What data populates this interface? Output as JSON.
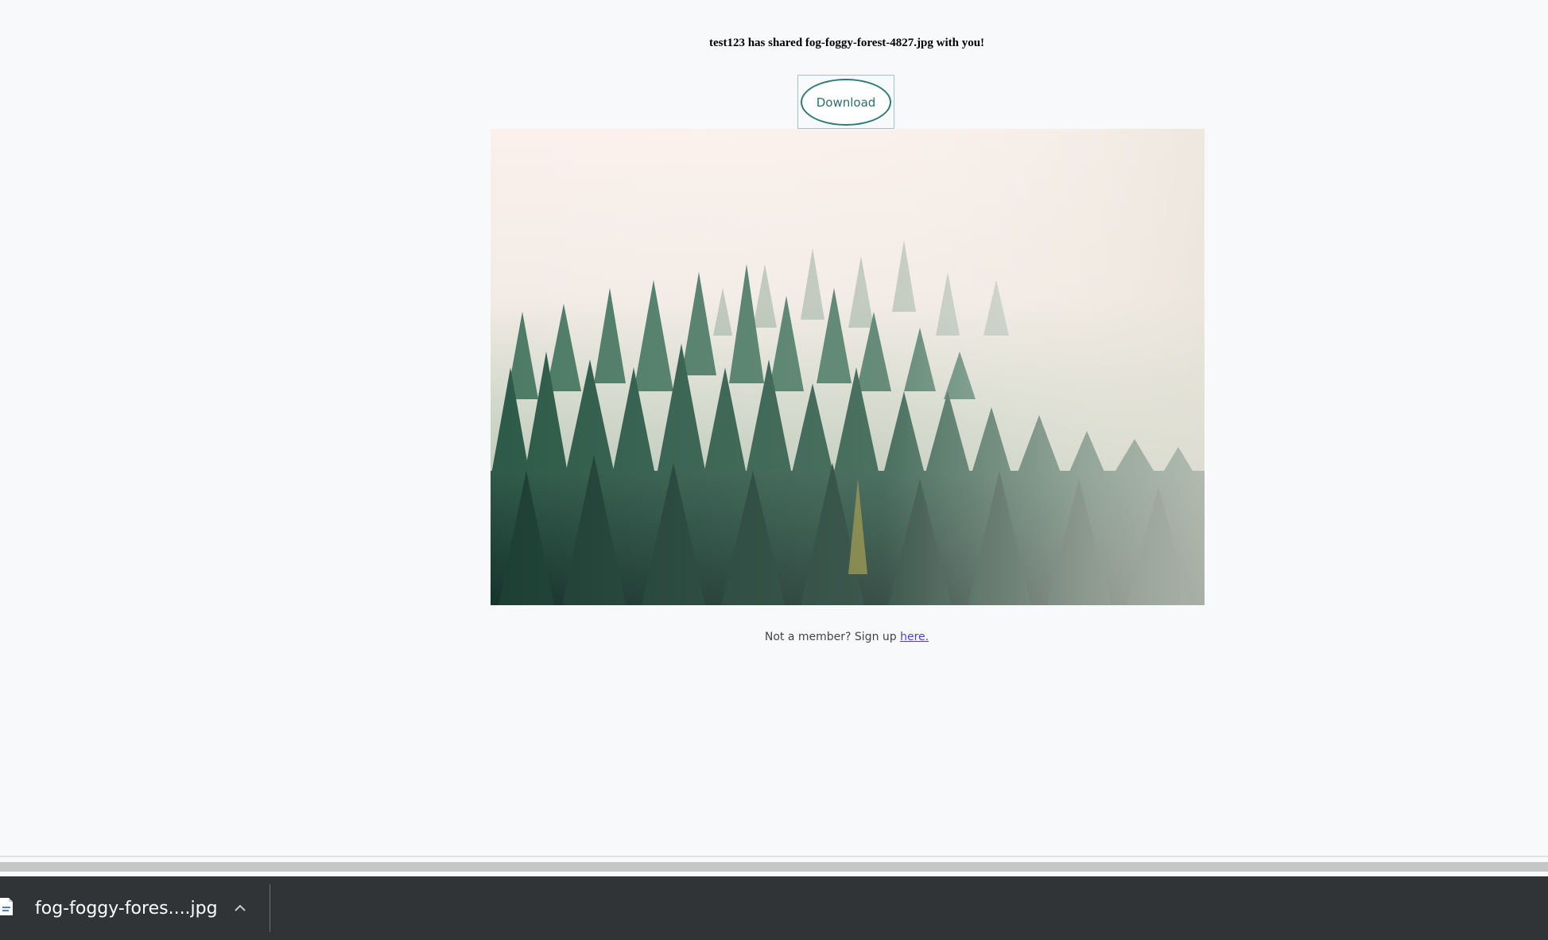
{
  "share": {
    "heading": "test123 has shared fog-foggy-forest-4827.jpg with you!"
  },
  "actions": {
    "download_label": "Download"
  },
  "shared_image": {
    "alt": "fog-foggy-forest-4827.jpg"
  },
  "signup": {
    "prompt": "Not a member? Sign up ",
    "link_label": "here."
  },
  "download_shelf": {
    "filename": "fog-foggy-fores....jpg",
    "file_icon": "image-file-icon",
    "menu_icon": "chevron-up-icon"
  },
  "colors": {
    "page_background": "#f8f9fb",
    "button_accent": "#2f7a78",
    "link": "#4a3fd0",
    "shelf_background": "#303437"
  }
}
